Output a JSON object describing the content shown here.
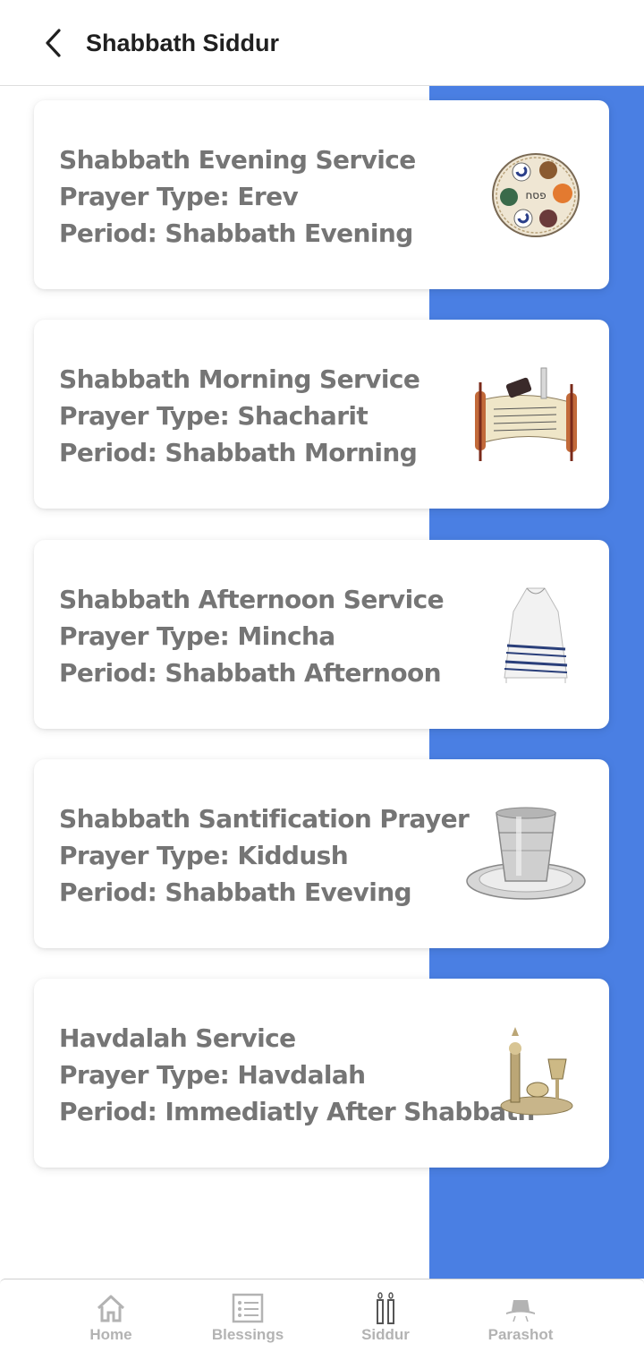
{
  "header": {
    "title": "Shabbath Siddur",
    "back_icon": "chevron-left-icon"
  },
  "colors": {
    "accent": "#4a7fe3",
    "card_text": "#757575",
    "nav_inactive": "#b3b3b3"
  },
  "prayers": [
    {
      "name": "Shabbath Evening Service",
      "type": "Prayer Type: Erev",
      "period": "Period: Shabbath Evening",
      "image": "seder-plate-image"
    },
    {
      "name": "Shabbath Morning Service",
      "type": "Prayer Type: Shacharit",
      "period": "Period: Shabbath Morning",
      "image": "torah-scroll-image"
    },
    {
      "name": "Shabbath Afternoon Service",
      "type": "Prayer Type: Mincha",
      "period": "Period: Shabbath Afternoon",
      "image": "tallit-image"
    },
    {
      "name": "Shabbath Santification Prayer",
      "type": "Prayer Type: Kiddush",
      "period": "Period: Shabbath Eveving",
      "image": "kiddush-cup-image"
    },
    {
      "name": "Havdalah Service",
      "type": "Prayer Type: Havdalah",
      "period": "Period: Immediatly After Shabbath",
      "image": "havdalah-set-image"
    }
  ],
  "bottom_nav": [
    {
      "label": "Home",
      "icon": "home-icon"
    },
    {
      "label": "Blessings",
      "icon": "list-icon"
    },
    {
      "label": "Siddur",
      "icon": "candles-icon"
    },
    {
      "label": "Parashot",
      "icon": "hat-icon"
    }
  ]
}
